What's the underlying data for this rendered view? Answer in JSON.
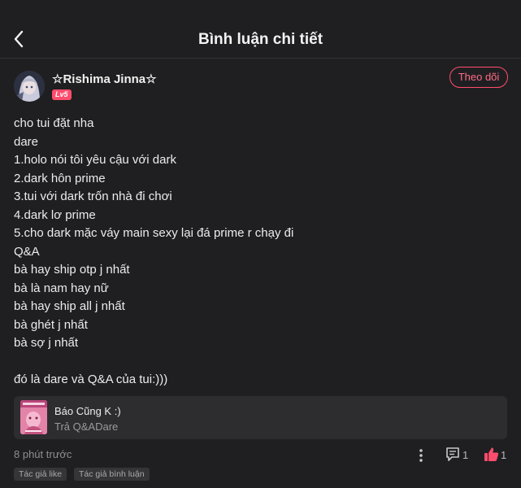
{
  "header": {
    "title": "Bình luận chi tiết",
    "back_icon": "chevron-left-icon"
  },
  "author": {
    "name": "☆Rishima Jinna☆",
    "level": "Lv5",
    "follow_label": "Theo dõi"
  },
  "comment": {
    "lines": [
      "cho tui đặt nha",
      "dare",
      "1.holo nói tôi yêu cậu với dark",
      "2.dark hôn prime",
      "3.tui với dark trốn nhà đi chơi",
      "4.dark lơ prime",
      "5.cho dark mặc váy main sexy lại đá prime r chạy đi",
      "Q&A",
      "bà hay ship otp j nhất",
      "bà là nam hay nữ",
      "bà hay ship all j nhất",
      "bà ghét j nhất",
      "bà sợ j nhất",
      "",
      "đó là dare và Q&A của tui:)))"
    ]
  },
  "linked_story": {
    "title": "Báo Cũng K :)",
    "subtitle": "Trả Q&ADare"
  },
  "footer": {
    "time": "8 phút trước",
    "comment_count": "1",
    "like_count": "1",
    "tags": [
      "Tác giả like",
      "Tác giả bình luận"
    ]
  },
  "colors": {
    "background": "#1f1f21",
    "accent": "#ff4d6d",
    "card": "#2d2d30",
    "muted_text": "#8e8e93"
  }
}
